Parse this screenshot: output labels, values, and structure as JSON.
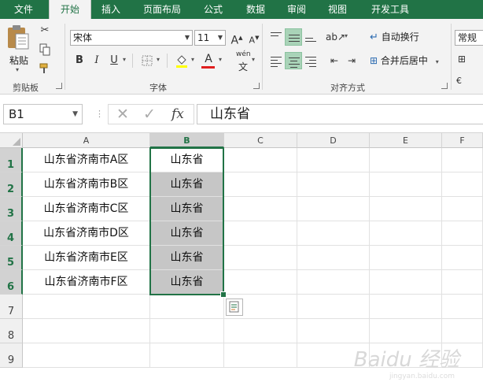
{
  "tabs": [
    "文件",
    "开始",
    "插入",
    "页面布局",
    "公式",
    "数据",
    "审阅",
    "视图",
    "开发工具"
  ],
  "active_tab": "开始",
  "clipboard": {
    "paste_label": "粘贴",
    "group_label": "剪贴板"
  },
  "font": {
    "name": "宋体",
    "size": "11",
    "grow_label": "A",
    "shrink_label": "A",
    "bold": "B",
    "italic": "I",
    "underline": "U",
    "font_color_label": "A",
    "phonetic_label": "wén",
    "group_label": "字体"
  },
  "alignment": {
    "wrap_label": "自动换行",
    "merge_label": "合并后居中",
    "group_label": "对齐方式"
  },
  "number": {
    "format_value": "常规"
  },
  "formula_bar": {
    "name_box": "B1",
    "cancel": "✕",
    "enter": "✓",
    "fx": "fx",
    "content": "山东省"
  },
  "grid": {
    "columns": [
      "A",
      "B",
      "C",
      "D",
      "E",
      "F"
    ],
    "selected_column": "B",
    "rows": [
      {
        "num": "1",
        "a": "山东省济南市A区",
        "b": "山东省"
      },
      {
        "num": "2",
        "a": "山东省济南市B区",
        "b": "山东省"
      },
      {
        "num": "3",
        "a": "山东省济南市C区",
        "b": "山东省"
      },
      {
        "num": "4",
        "a": "山东省济南市D区",
        "b": "山东省"
      },
      {
        "num": "5",
        "a": "山东省济南市E区",
        "b": "山东省"
      },
      {
        "num": "6",
        "a": "山东省济南市F区",
        "b": "山东省"
      },
      {
        "num": "7",
        "a": "",
        "b": ""
      },
      {
        "num": "8",
        "a": "",
        "b": ""
      },
      {
        "num": "9",
        "a": "",
        "b": ""
      }
    ]
  },
  "watermark": {
    "text": "Baidu 经验",
    "sub": "jingyan.baidu.com"
  },
  "colors": {
    "accent": "#217346",
    "selection_fill": "#c6c6c6",
    "header_bg": "#f0f0f0"
  }
}
